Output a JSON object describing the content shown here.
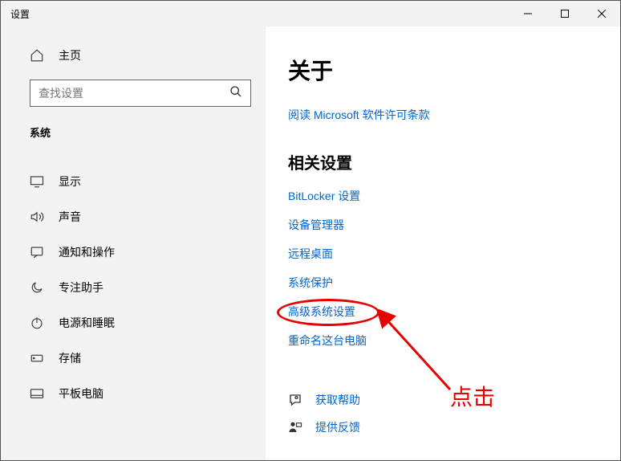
{
  "window": {
    "title": "设置"
  },
  "sidebar": {
    "home_label": "主页",
    "search_placeholder": "查找设置",
    "category_label": "系统",
    "items": [
      {
        "label": "显示"
      },
      {
        "label": "声音"
      },
      {
        "label": "通知和操作"
      },
      {
        "label": "专注助手"
      },
      {
        "label": "电源和睡眠"
      },
      {
        "label": "存储"
      },
      {
        "label": "平板电脑"
      }
    ]
  },
  "main": {
    "title": "关于",
    "license_link": "阅读 Microsoft 软件许可条款",
    "related_heading": "相关设置",
    "related_links": [
      "BitLocker 设置",
      "设备管理器",
      "远程桌面",
      "系统保护",
      "高级系统设置",
      "重命名这台电脑"
    ],
    "help": {
      "get_help_label": "获取帮助",
      "feedback_label": "提供反馈"
    }
  },
  "annotation": {
    "text": "点击"
  }
}
